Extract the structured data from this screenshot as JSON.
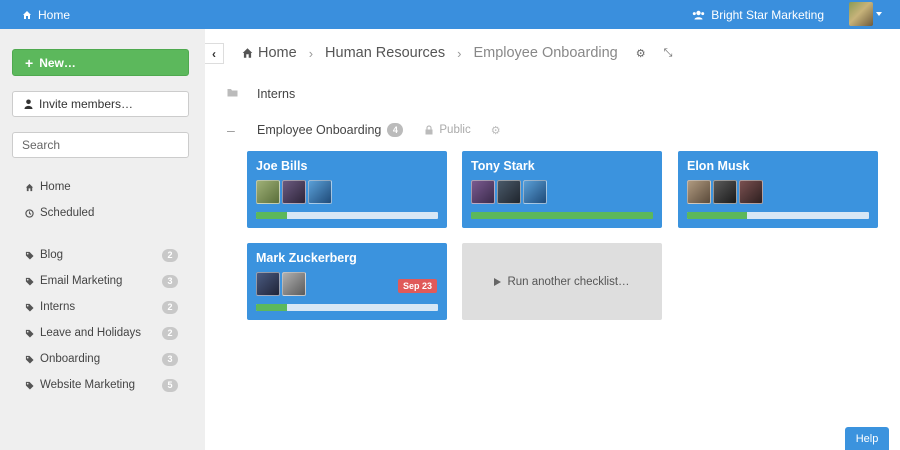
{
  "topbar": {
    "home_label": "Home",
    "org_name": "Bright Star Marketing"
  },
  "sidebar": {
    "new_label": "New…",
    "invite_label": "Invite members…",
    "search_placeholder": "Search",
    "primary_nav": [
      {
        "label": "Home",
        "icon": "home-icon"
      },
      {
        "label": "Scheduled",
        "icon": "clock-icon"
      }
    ],
    "tags": [
      {
        "label": "Blog",
        "count": "2"
      },
      {
        "label": "Email Marketing",
        "count": "3"
      },
      {
        "label": "Interns",
        "count": "2"
      },
      {
        "label": "Leave and Holidays",
        "count": "2"
      },
      {
        "label": "Onboarding",
        "count": "3"
      },
      {
        "label": "Website Marketing",
        "count": "5"
      }
    ]
  },
  "breadcrumb": {
    "home": "Home",
    "section": "Human Resources",
    "current": "Employee Onboarding"
  },
  "groups": {
    "interns": {
      "label": "Interns"
    },
    "onboarding": {
      "label": "Employee Onboarding",
      "count": "4",
      "visibility": "Public"
    }
  },
  "cards": [
    {
      "name": "Joe Bills",
      "progress": 0.17,
      "avatars": [
        "#7a8f5b",
        "#5a4a6e",
        "#2f6fa8"
      ]
    },
    {
      "name": "Tony Stark",
      "progress": 1.0,
      "avatars": [
        "#6b4a7a",
        "#2d3a4a",
        "#3a7fb5"
      ]
    },
    {
      "name": "Elon Musk",
      "progress": 0.33,
      "avatars": [
        "#8b7a6a",
        "#3a3a3a",
        "#5a3a3a"
      ]
    },
    {
      "name": "Mark Zuckerberg",
      "progress": 0.17,
      "avatars": [
        "#3a4a6a",
        "#8a8a8a"
      ],
      "due": "Sep 23"
    }
  ],
  "run_another_label": "Run another checklist…",
  "help_label": "Help",
  "colors": {
    "topbar": "#3a8fdd",
    "card": "#3b93de",
    "progress_fill": "#5cb85c",
    "due_badge": "#e05a5a"
  }
}
